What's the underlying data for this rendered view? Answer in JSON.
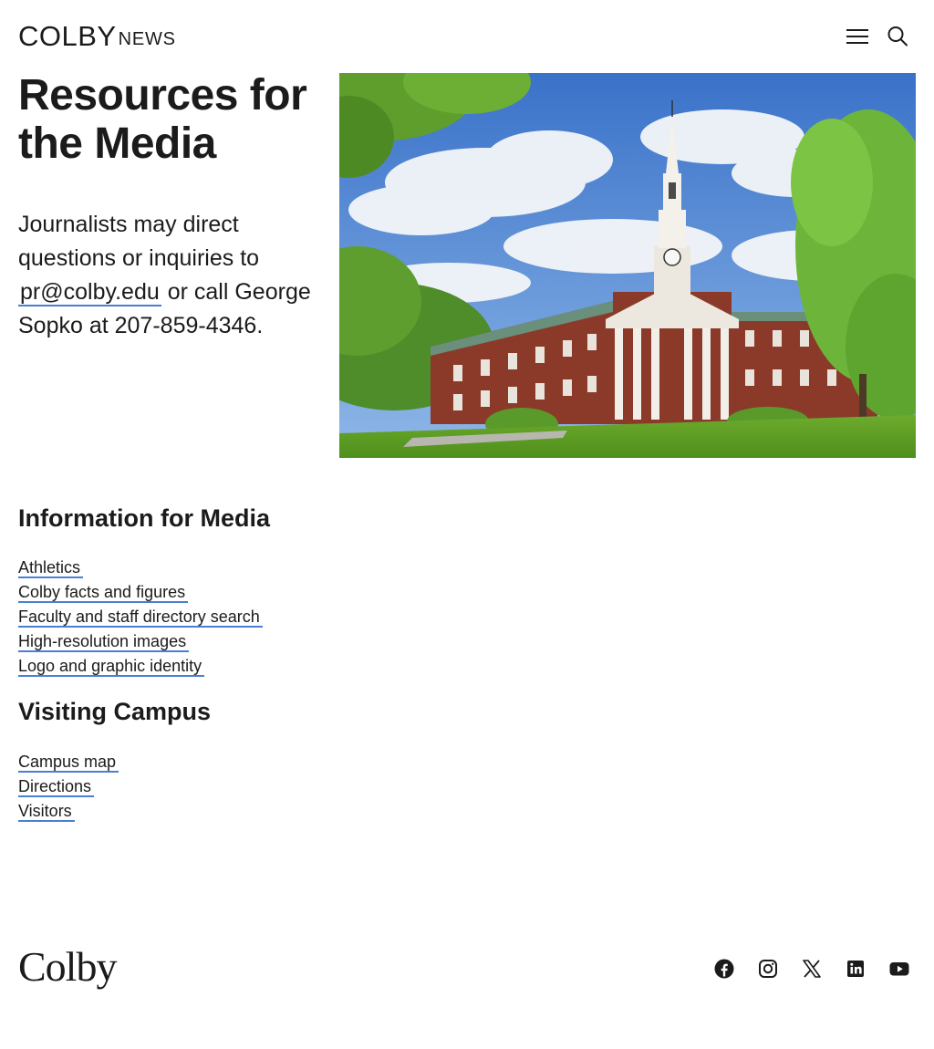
{
  "header": {
    "logo_colby": "COLBY",
    "logo_news": "NEWS"
  },
  "hero": {
    "title": "Resources for the Media",
    "text_before": "Journalists may direct questions or inquiries to ",
    "email_link": "pr@colby.edu",
    "text_after": " or call George Sopko at 207-859-4346.",
    "image_alt": "Miller Library clock tower at Colby College"
  },
  "sections": [
    {
      "heading": "Information for Media",
      "links": [
        "Athletics",
        "Colby facts and figures",
        "Faculty and staff directory search",
        "High-resolution images",
        "Logo and graphic identity"
      ]
    },
    {
      "heading": "Visiting Campus",
      "links": [
        "Campus map",
        "Directions",
        "Visitors"
      ]
    }
  ],
  "footer": {
    "logo": "Colby",
    "social": [
      "facebook-icon",
      "instagram-icon",
      "x-icon",
      "linkedin-icon",
      "youtube-icon"
    ]
  },
  "colors": {
    "text": "#1b1b1b",
    "link_underline": "#4a7fd4"
  }
}
